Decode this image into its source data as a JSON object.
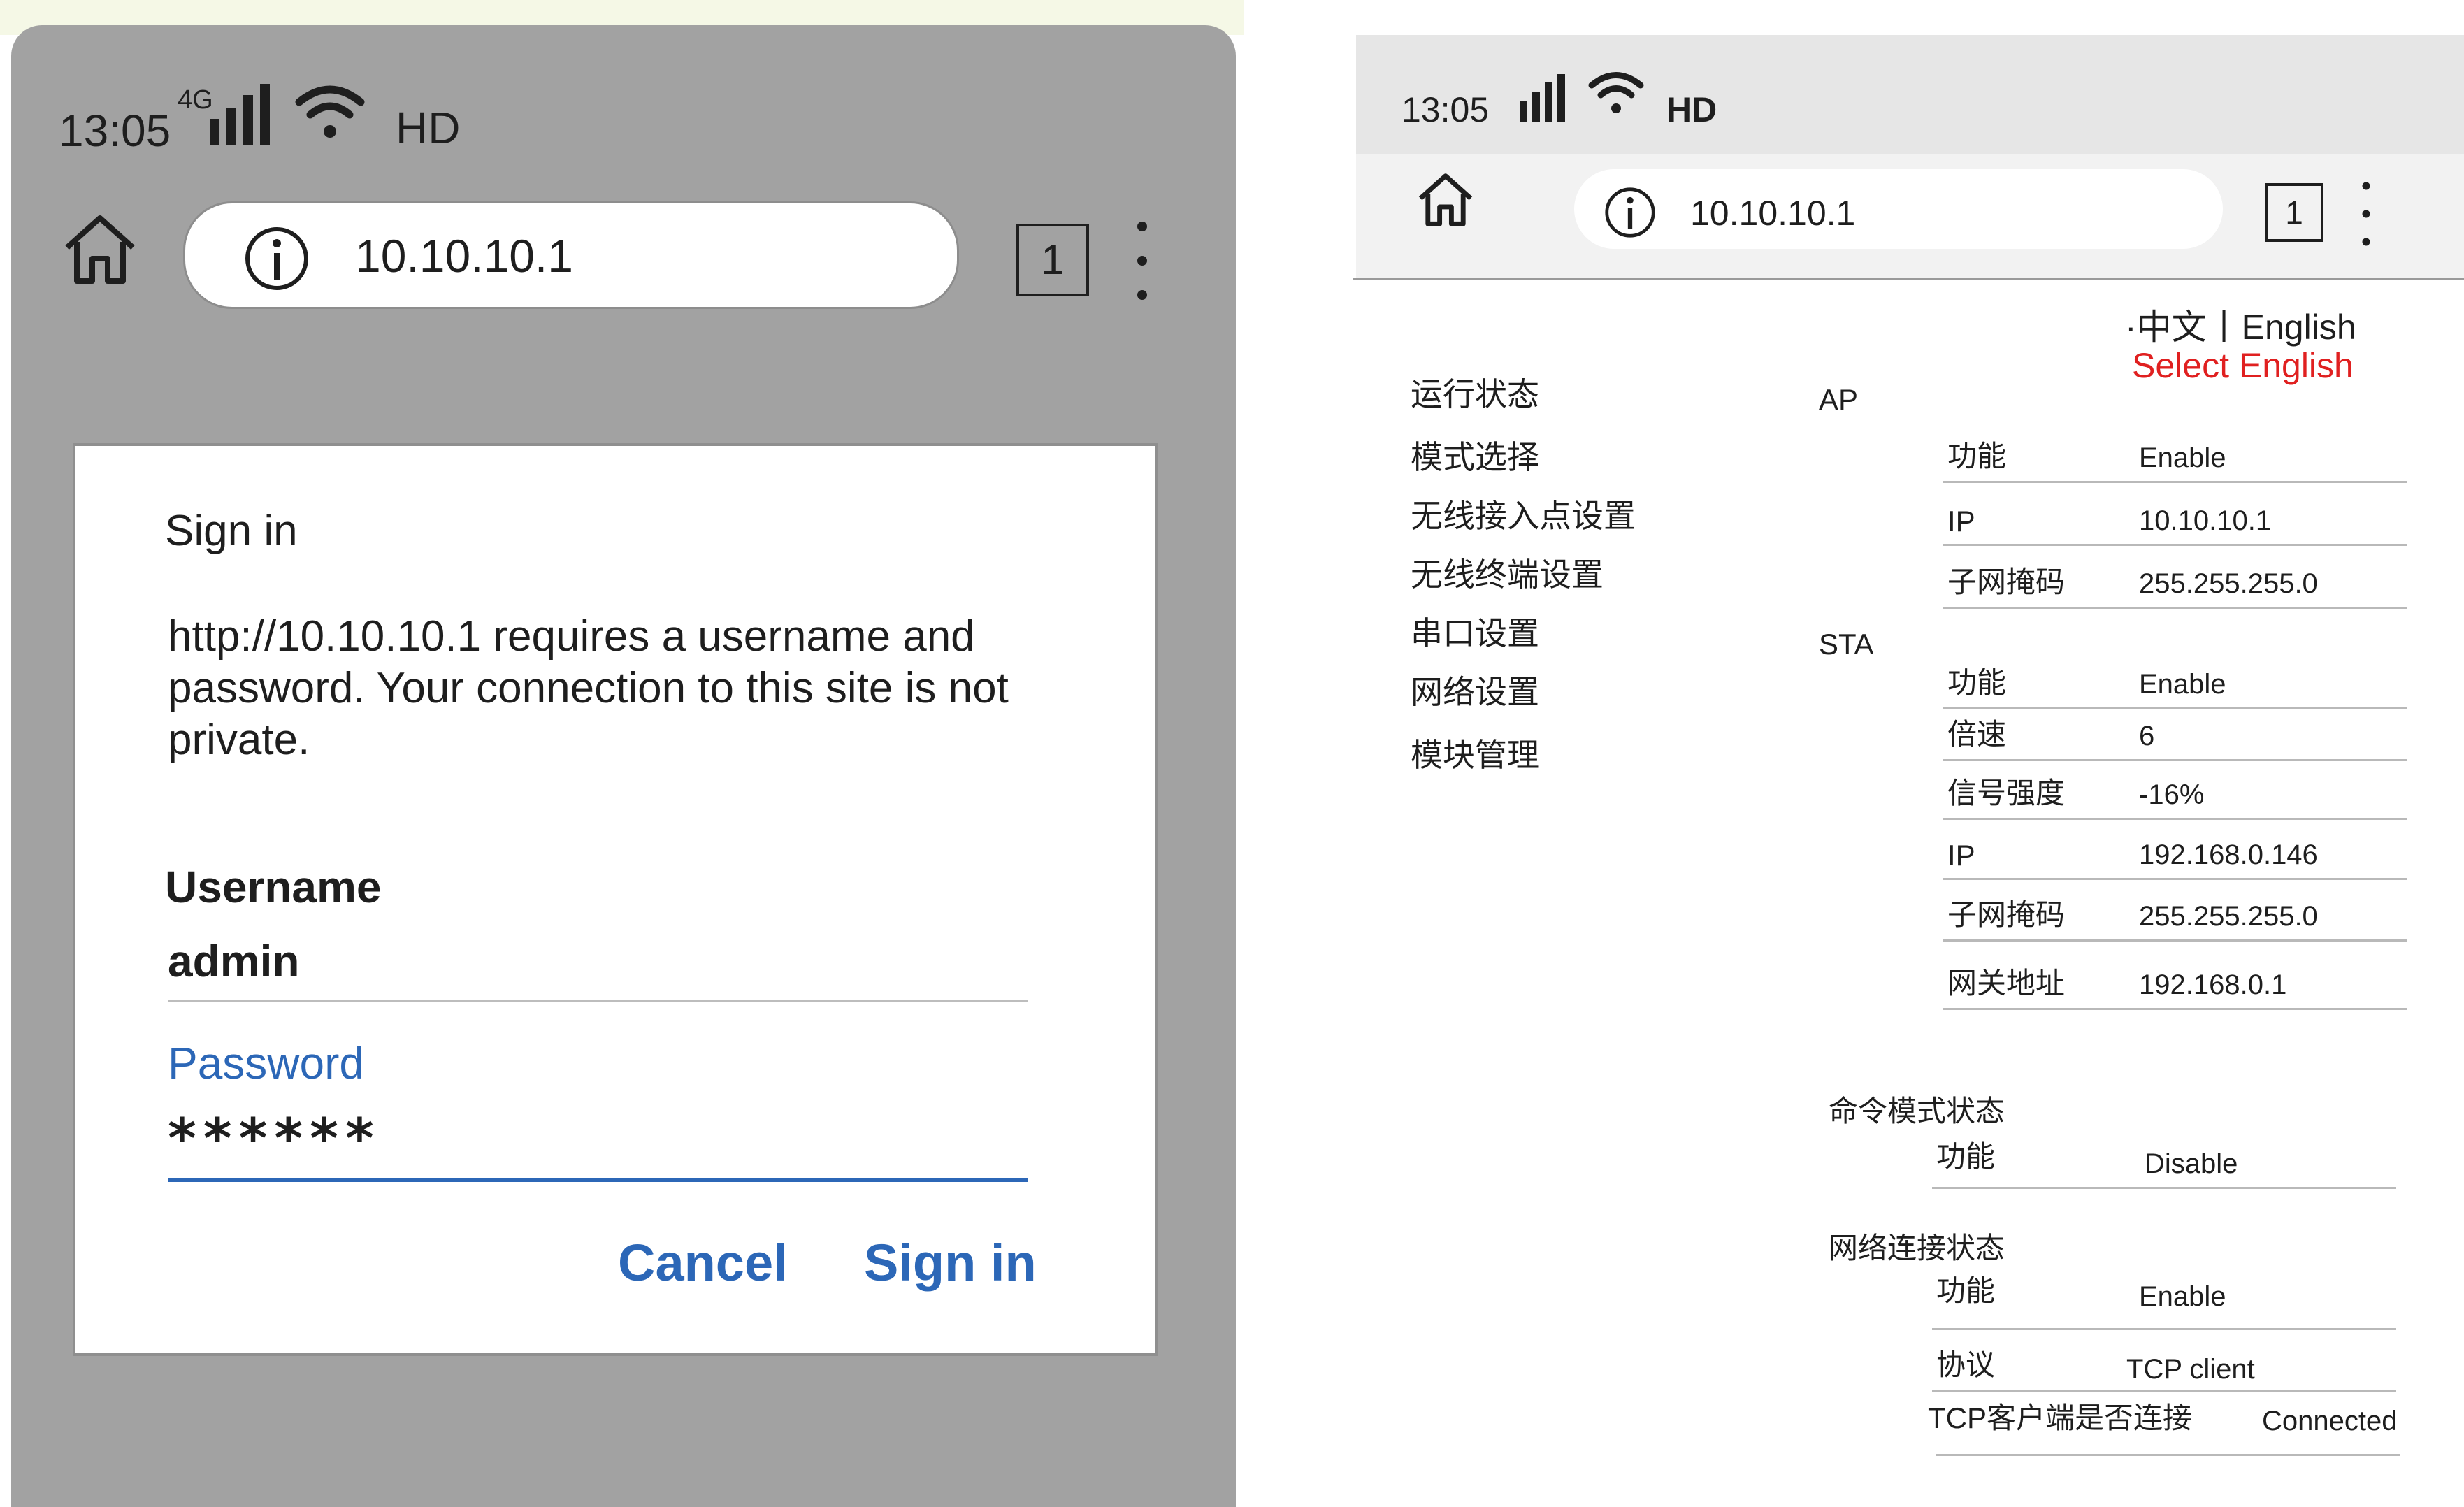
{
  "left_screen": {
    "status": {
      "time": "13:05",
      "network": "4G",
      "display": "HD"
    },
    "browser": {
      "url": "10.10.10.1",
      "tab_count": "1"
    },
    "dialog": {
      "title": "Sign in",
      "message": "http://10.10.10.1 requires a username and password. Your connection to this site is not private.",
      "username_label": "Username",
      "username_value": "admin",
      "password_label": "Password",
      "password_mask": "******",
      "cancel_label": "Cancel",
      "signin_label": "Sign in"
    }
  },
  "right_screen": {
    "status": {
      "time": "13:05",
      "display": "HD"
    },
    "browser": {
      "url": "10.10.10.1",
      "tab_count": "1"
    },
    "language": {
      "switcher": "·中文丨English",
      "hint": "Select English"
    },
    "nav": [
      "运行状态",
      "模式选择",
      "无线接入点设置",
      "无线终端设置",
      "串口设置",
      "网络设置",
      "模块管理"
    ],
    "sections": {
      "ap": {
        "title": "AP",
        "rows": [
          {
            "key": "功能",
            "value": "Enable"
          },
          {
            "key": "IP",
            "value": "10.10.10.1"
          },
          {
            "key": "子网掩码",
            "value": "255.255.255.0"
          }
        ]
      },
      "sta": {
        "title": "STA",
        "rows": [
          {
            "key": "功能",
            "value": "Enable"
          },
          {
            "key": "倍速",
            "value": "6"
          },
          {
            "key": "信号强度",
            "value": "-16%"
          },
          {
            "key": "IP",
            "value": "192.168.0.146"
          },
          {
            "key": "子网掩码",
            "value": "255.255.255.0"
          },
          {
            "key": "网关地址",
            "value": "192.168.0.1"
          }
        ]
      },
      "command_mode": {
        "title": "命令模式状态",
        "rows": [
          {
            "key": "功能",
            "value": "Disable"
          }
        ]
      },
      "network_connection": {
        "title": "网络连接状态",
        "rows": [
          {
            "key": "功能",
            "value": "Enable"
          },
          {
            "key": "协议",
            "value": "TCP client"
          },
          {
            "key": "TCP客户端是否连接",
            "value": "Connected"
          }
        ]
      }
    }
  },
  "colors": {
    "accent_blue": "#2c67b7",
    "hint_red": "#e02020",
    "panel_gray": "#a2a2a2"
  }
}
